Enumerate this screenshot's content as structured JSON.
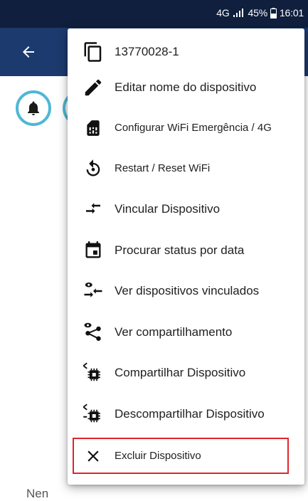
{
  "status": {
    "network": "4G",
    "battery": "45%",
    "time": "16:01"
  },
  "background": {
    "partial_text": "Nen"
  },
  "menu": {
    "items": [
      {
        "label": "13770028-1",
        "icon": "copy-icon"
      },
      {
        "label": "Editar nome do dispositivo",
        "icon": "edit-pencil-icon"
      },
      {
        "label": "Configurar WiFi Emergência / 4G",
        "icon": "sim-card-icon"
      },
      {
        "label": "Restart / Reset WiFi",
        "icon": "restart-icon"
      },
      {
        "label": "Vincular Dispositivo",
        "icon": "link-arrows-icon"
      },
      {
        "label": "Procurar status por data",
        "icon": "calendar-icon"
      },
      {
        "label": "Ver dispositivos vinculados",
        "icon": "linked-devices-icon"
      },
      {
        "label": "Ver compartilhamento",
        "icon": "share-view-icon"
      },
      {
        "label": "Compartilhar Dispositivo",
        "icon": "share-chip-icon"
      },
      {
        "label": "Descompartilhar Dispositivo",
        "icon": "unshare-chip-icon"
      },
      {
        "label": "Excluir Dispositivo",
        "icon": "close-icon"
      }
    ]
  },
  "colors": {
    "status_bar": "#0f1f3d",
    "app_bar": "#1d3a6e",
    "accent": "#4fb7d6",
    "highlight": "#e0252b"
  }
}
